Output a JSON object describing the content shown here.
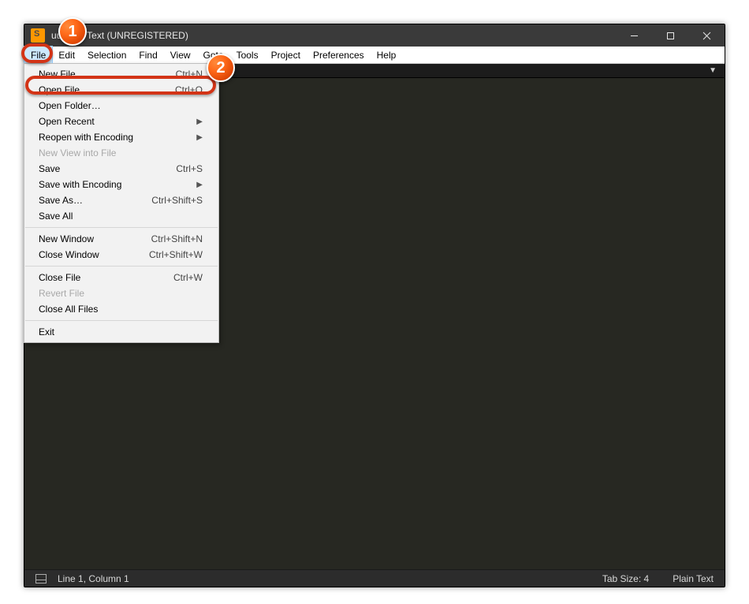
{
  "title": "ublime Text (UNREGISTERED)",
  "title_prefix": "u",
  "menubar": [
    "File",
    "Edit",
    "Selection",
    "Find",
    "View",
    "Goto",
    "Tools",
    "Project",
    "Preferences",
    "Help"
  ],
  "dropdown": {
    "groups": [
      [
        {
          "label": "New File",
          "shortcut": "Ctrl+N"
        },
        {
          "label": "Open File…",
          "shortcut": "Ctrl+O"
        },
        {
          "label": "Open Folder…"
        },
        {
          "label": "Open Recent",
          "submenu": true
        },
        {
          "label": "Reopen with Encoding",
          "submenu": true
        },
        {
          "label": "New View into File",
          "disabled": true
        },
        {
          "label": "Save",
          "shortcut": "Ctrl+S"
        },
        {
          "label": "Save with Encoding",
          "submenu": true
        },
        {
          "label": "Save As…",
          "shortcut": "Ctrl+Shift+S"
        },
        {
          "label": "Save All"
        }
      ],
      [
        {
          "label": "New Window",
          "shortcut": "Ctrl+Shift+N"
        },
        {
          "label": "Close Window",
          "shortcut": "Ctrl+Shift+W"
        }
      ],
      [
        {
          "label": "Close File",
          "shortcut": "Ctrl+W"
        },
        {
          "label": "Revert File",
          "disabled": true
        },
        {
          "label": "Close All Files"
        }
      ],
      [
        {
          "label": "Exit"
        }
      ]
    ]
  },
  "statusbar": {
    "position": "Line 1, Column 1",
    "tab": "Tab Size: 4",
    "syntax": "Plain Text"
  },
  "annotations": {
    "badge1": "1",
    "badge2": "2"
  }
}
